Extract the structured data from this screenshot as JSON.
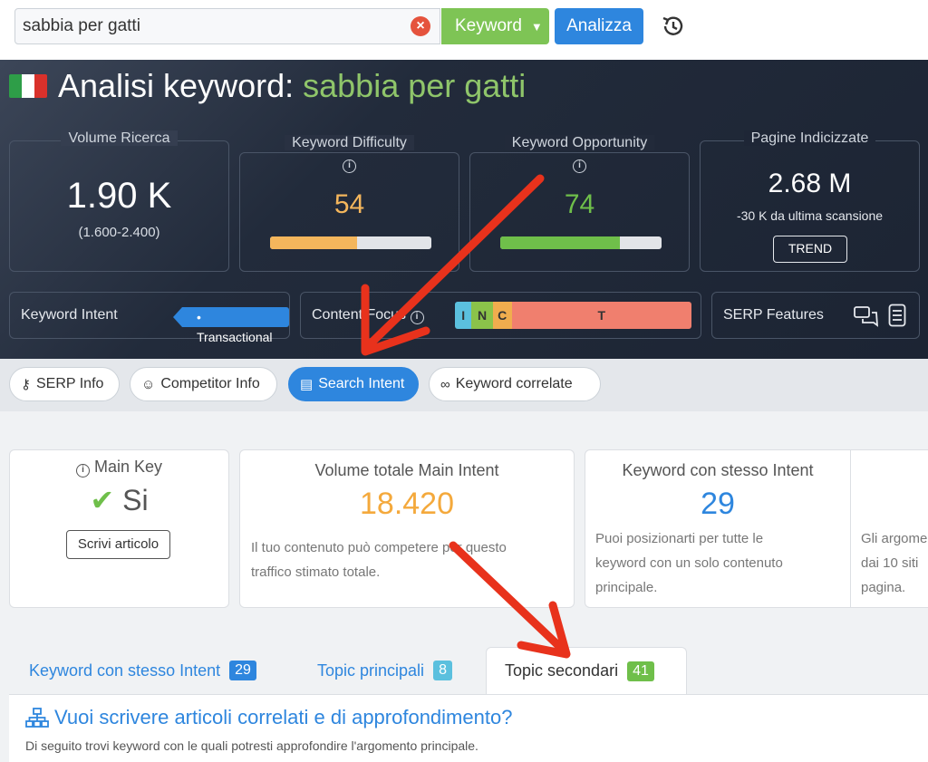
{
  "search": {
    "value": "sabbia per gatti",
    "mode_label": "Keyword",
    "analyze_label": "Analizza"
  },
  "header": {
    "title_prefix": "Analisi keyword:",
    "keyword": "sabbia per gatti"
  },
  "metrics": {
    "volume": {
      "title": "Volume Ricerca",
      "value": "1.90 K",
      "range": "(1.600-2.400)"
    },
    "difficulty": {
      "title": "Keyword Difficulty",
      "value": "54",
      "level": 0.54,
      "color": "#f4b65c"
    },
    "opportunity": {
      "title": "Keyword Opportunity",
      "value": "74",
      "level": 0.74,
      "color": "#6fbf4a"
    },
    "indexed": {
      "title": "Pagine Indicizzate",
      "value": "2.68 M",
      "delta": "-30 K da ultima scansione",
      "trend_label": "TREND"
    }
  },
  "row2": {
    "intent_label": "Keyword Intent",
    "intent_value": "• Transactional",
    "content_focus_label": "Content Focus",
    "segments": [
      {
        "letter": "I",
        "color": "#5bc0de",
        "share": 0.07
      },
      {
        "letter": "N",
        "color": "#8bc34a",
        "share": 0.09
      },
      {
        "letter": "C",
        "color": "#f0ad4e",
        "share": 0.08
      },
      {
        "letter": "T",
        "color": "#f07f6e",
        "share": 0.76
      }
    ],
    "serp_label": "SERP Features"
  },
  "tabs": [
    {
      "label": "SERP Info",
      "icon": "key-icon",
      "active": false
    },
    {
      "label": "Competitor Info",
      "icon": "robot-icon",
      "active": false
    },
    {
      "label": "Search Intent",
      "icon": "document-icon",
      "active": true
    },
    {
      "label": "Keyword correlate",
      "icon": "infinity-icon",
      "active": false
    }
  ],
  "cards": {
    "main_key": {
      "caption": "Main Key",
      "value": "Si",
      "button": "Scrivi articolo"
    },
    "volume_main": {
      "caption": "Volume totale Main Intent",
      "value": "18.420",
      "desc_1": "Il tuo contenuto può competere per questo",
      "desc_2": "traffico stimato totale."
    },
    "same_intent": {
      "caption": "Keyword con stesso Intent",
      "value": "29",
      "desc_1": "Puoi posizionarti per tutte le",
      "desc_2": "keyword con un solo contenuto",
      "desc_3": "principale."
    },
    "partial": {
      "desc_1": "Gli argome",
      "desc_2": "dai 10 siti",
      "desc_3": "pagina."
    }
  },
  "lower_tabs": [
    {
      "label": "Keyword con stesso Intent",
      "count": "29",
      "count_color": "#2e86de"
    },
    {
      "label": "Topic principali",
      "count": "8",
      "count_color": "#5bc0de"
    },
    {
      "label": "Topic secondari",
      "count": "41",
      "count_color": "#6fbf4a"
    }
  ],
  "section": {
    "title": "Vuoi scrivere articoli correlati e di approfondimento?",
    "subtitle": "Di seguito trovi keyword con le quali potresti approfondire l'argomento principale."
  },
  "colors": {
    "accent": "#2e86de",
    "green": "#7ec455",
    "arrow": "#e8321c"
  }
}
